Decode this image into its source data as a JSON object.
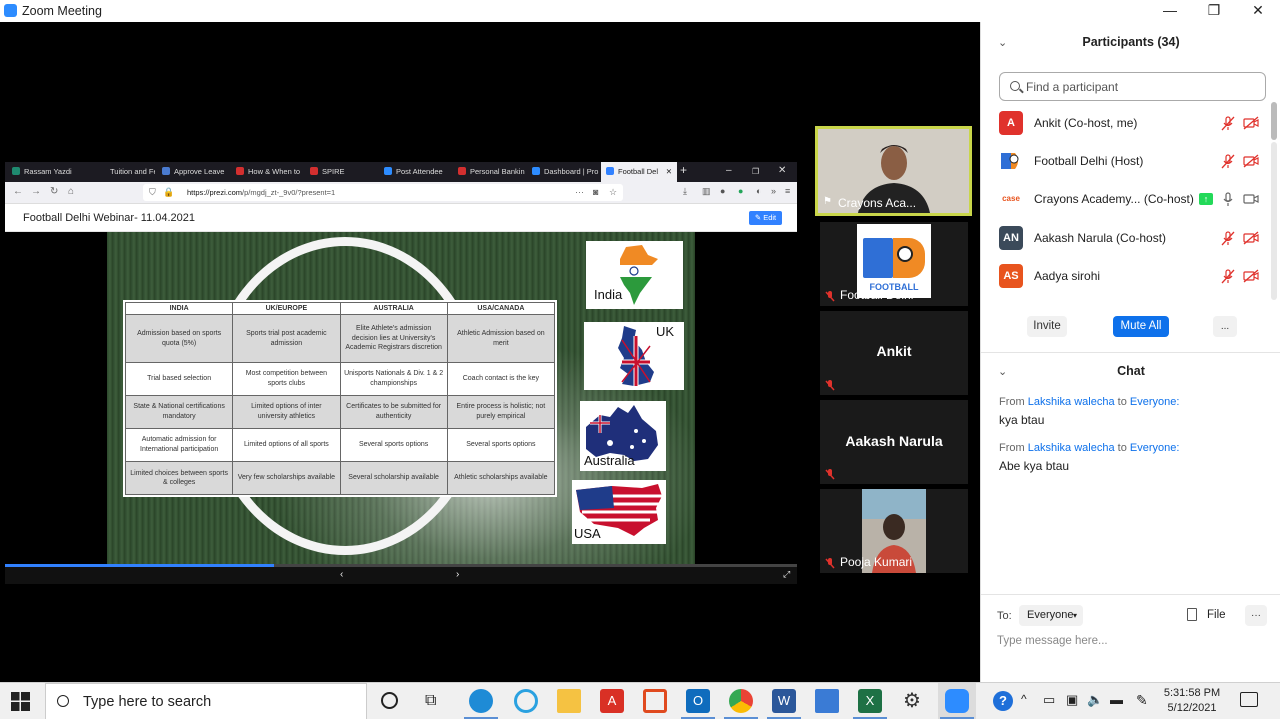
{
  "window": {
    "title": "Zoom Meeting",
    "controls": [
      "—",
      "❐",
      "✕"
    ]
  },
  "browser": {
    "tabs": [
      {
        "label": "Rassam Yazdi",
        "color": "#1f8a70"
      },
      {
        "label": "Tuition and Fee",
        "color": "#ffffff"
      },
      {
        "label": "Approve Leave",
        "color": "#4a7bd0"
      },
      {
        "label": "How & When to",
        "color": "#d32f2f"
      },
      {
        "label": "SPIRE",
        "color": "#d32f2f"
      },
      {
        "label": "Post Attendee",
        "color": "#2D8CFF"
      },
      {
        "label": "Personal Bankin",
        "color": "#d32f2f"
      },
      {
        "label": "Dashboard | Pro",
        "color": "#2D8CFF"
      },
      {
        "label": "Football Del",
        "color": "#3181ff"
      }
    ],
    "url_host": "https://prezi.com",
    "url_path": "/p/mgdj_zt-_9v0/?present=1",
    "prezi_title": "Football Delhi Webinar- 11.04.2021",
    "edit_label": "✎ Edit",
    "progress": 0.34
  },
  "slide": {
    "headers": [
      "INDIA",
      "UK/EUROPE",
      "AUSTRALIA",
      "USA/CANADA"
    ],
    "rows": [
      [
        "Admission based on sports quota (5%)",
        "Sports trial post academic admission",
        "Elite Athlete's admission decision lies at University's Academic Registrars discretion",
        "Athletic Admission based on merit"
      ],
      [
        "Trial based selection",
        "Most competition between sports clubs",
        "Unisports Nationals & Div. 1 & 2 championships",
        "Coach contact is the key"
      ],
      [
        "State & National certifications mandatory",
        "Limited options of inter university athletics",
        "Certificates to be submitted for authenticity",
        "Entire process is holistic; not purely empirical"
      ],
      [
        "Automatic admission for International participation",
        "Limited options of all sports",
        "Several sports options",
        "Several sports options"
      ],
      [
        "Limited choices between sports & colleges",
        "Very few scholarships available",
        "Several scholarship available",
        "Athletic scholarships available"
      ]
    ],
    "flags": [
      "India",
      "UK",
      "Australia",
      "USA"
    ]
  },
  "gallery": {
    "tiles": [
      {
        "name": "Crayons Aca...",
        "kind": "video"
      },
      {
        "name": "Football Delhi",
        "kind": "logo",
        "logo_text": "FOOTBALL"
      },
      {
        "name": "Ankit",
        "kind": "name"
      },
      {
        "name": "Aakash Narula",
        "kind": "name"
      },
      {
        "name": "Pooja Kumari",
        "kind": "video"
      }
    ]
  },
  "participants": {
    "title": "Participants (34)",
    "search_placeholder": "Find a participant",
    "list": [
      {
        "name": "Ankit (Co-host, me)",
        "avatar_text": "A",
        "avatar_color": "#e0322c",
        "muted": true
      },
      {
        "name": "Football Delhi (Host)",
        "avatar_text": "",
        "avatar_color": "#2196f3",
        "muted": true
      },
      {
        "name": "Crayons Academy... (Co-host)",
        "avatar_text": "case",
        "avatar_color": "#ffffff",
        "muted": false,
        "sharing": true
      },
      {
        "name": "Aakash Narula (Co-host)",
        "avatar_text": "AN",
        "avatar_color": "#3b4a5a",
        "muted": true
      },
      {
        "name": "Aadya sirohi",
        "avatar_text": "AS",
        "avatar_color": "#e8541e",
        "muted": true
      }
    ],
    "buttons": {
      "invite": "Invite",
      "mute_all": "Mute All",
      "more": "..."
    }
  },
  "chat": {
    "title": "Chat",
    "messages": [
      {
        "prefix": "From",
        "sender": "Lakshika walecha",
        "to": "to",
        "recipient": "Everyone:",
        "text": "kya btau"
      },
      {
        "prefix": "From",
        "sender": "Lakshika walecha",
        "to": "to",
        "recipient": "Everyone:",
        "text": "Abe kya btau"
      }
    ],
    "to_label": "To:",
    "to_value": "Everyone",
    "file_label": "File",
    "more_label": "···",
    "input_placeholder": "Type message here..."
  },
  "taskbar": {
    "search_placeholder": "Type here to search",
    "time": "5:31:58 PM",
    "date": "5/12/2021"
  },
  "colors": {
    "accent": "#0e71eb",
    "muted_red": "#e0322c",
    "active_green": "#23d959"
  }
}
